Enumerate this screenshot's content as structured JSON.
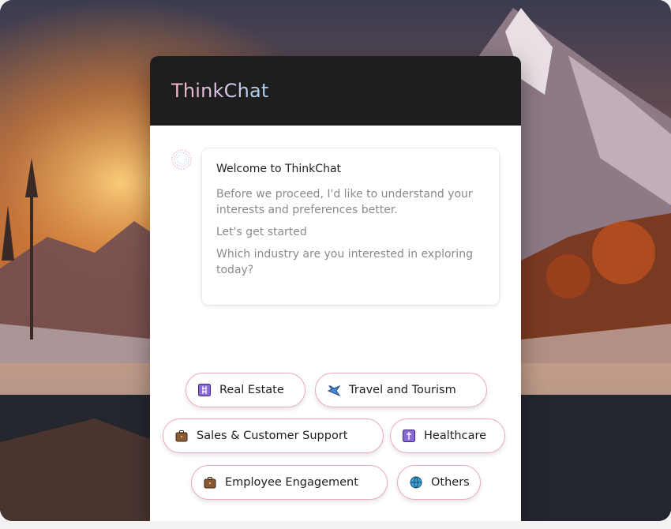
{
  "app": {
    "title": "ThinkChat"
  },
  "message": {
    "welcome": "Welcome to ThinkChat",
    "lines": [
      "Before we proceed, I'd like to understand your interests and preferences better.",
      "Let's get started",
      "Which industry are you interested in exploring today?"
    ]
  },
  "options": [
    {
      "label": "Real Estate",
      "icon": "building-icon"
    },
    {
      "label": "Travel and Tourism",
      "icon": "airplane-icon"
    },
    {
      "label": "Sales & Customer Support",
      "icon": "briefcase-icon"
    },
    {
      "label": "Healthcare",
      "icon": "medical-icon"
    },
    {
      "label": "Employee Engagement",
      "icon": "briefcase-icon"
    },
    {
      "label": "Others",
      "icon": "globe-icon"
    }
  ],
  "colors": {
    "header": "#1e1e1e",
    "chip_border": "#e7a9c3",
    "title_gradient": [
      "#f4b3c6",
      "#a8d2e8"
    ]
  }
}
